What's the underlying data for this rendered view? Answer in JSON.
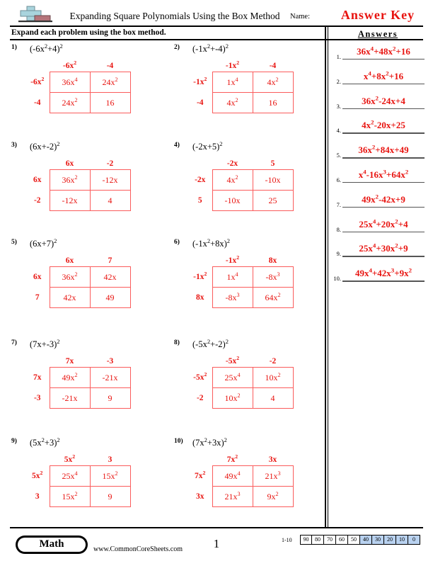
{
  "header": {
    "logo_icon": "plus-block-logo",
    "title": "Expanding Square Polynomials Using the Box Method",
    "name_label": "Name:",
    "name_value": "Answer Key",
    "instructions": "Expand each problem using the box method.",
    "accent_color": "#e8130f"
  },
  "answers_panel": {
    "title": "Answers",
    "items": [
      {
        "num": "1.",
        "value": "36x⁴+48x²+16"
      },
      {
        "num": "2.",
        "value": "x⁴+8x²+16"
      },
      {
        "num": "3.",
        "value": "36x²-24x+4"
      },
      {
        "num": "4.",
        "value": "4x²-20x+25"
      },
      {
        "num": "5.",
        "value": "36x²+84x+49"
      },
      {
        "num": "6.",
        "value": "x⁴-16x³+64x²"
      },
      {
        "num": "7.",
        "value": "49x²-42x+9"
      },
      {
        "num": "8.",
        "value": "25x⁴+20x²+4"
      },
      {
        "num": "9.",
        "value": "25x⁴+30x²+9"
      },
      {
        "num": "10.",
        "value": "49x⁴+42x³+9x²"
      }
    ]
  },
  "problems": [
    {
      "num": "1)",
      "expression": "(-6x²+4)²",
      "col_headers": [
        "-6x²",
        "-4"
      ],
      "row_headers": [
        "-6x²",
        "-4"
      ],
      "cells": [
        [
          "36x⁴",
          "24x²"
        ],
        [
          "24x²",
          "16"
        ]
      ]
    },
    {
      "num": "2)",
      "expression": "(-1x²+-4)²",
      "col_headers": [
        "-1x²",
        "-4"
      ],
      "row_headers": [
        "-1x²",
        "-4"
      ],
      "cells": [
        [
          "1x⁴",
          "4x²"
        ],
        [
          "4x²",
          "16"
        ]
      ]
    },
    {
      "num": "3)",
      "expression": "(6x+-2)²",
      "col_headers": [
        "6x",
        "-2"
      ],
      "row_headers": [
        "6x",
        "-2"
      ],
      "cells": [
        [
          "36x²",
          "-12x"
        ],
        [
          "-12x",
          "4"
        ]
      ]
    },
    {
      "num": "4)",
      "expression": "(-2x+5)²",
      "col_headers": [
        "-2x",
        "5"
      ],
      "row_headers": [
        "-2x",
        "5"
      ],
      "cells": [
        [
          "4x²",
          "-10x"
        ],
        [
          "-10x",
          "25"
        ]
      ]
    },
    {
      "num": "5)",
      "expression": "(6x+7)²",
      "col_headers": [
        "6x",
        "7"
      ],
      "row_headers": [
        "6x",
        "7"
      ],
      "cells": [
        [
          "36x²",
          "42x"
        ],
        [
          "42x",
          "49"
        ]
      ]
    },
    {
      "num": "6)",
      "expression": "(-1x²+8x)²",
      "col_headers": [
        "-1x²",
        "8x"
      ],
      "row_headers": [
        "-1x²",
        "8x"
      ],
      "cells": [
        [
          "1x⁴",
          "-8x³"
        ],
        [
          "-8x³",
          "64x²"
        ]
      ]
    },
    {
      "num": "7)",
      "expression": "(7x+-3)²",
      "col_headers": [
        "7x",
        "-3"
      ],
      "row_headers": [
        "7x",
        "-3"
      ],
      "cells": [
        [
          "49x²",
          "-21x"
        ],
        [
          "-21x",
          "9"
        ]
      ]
    },
    {
      "num": "8)",
      "expression": "(-5x²+-2)²",
      "col_headers": [
        "-5x²",
        "-2"
      ],
      "row_headers": [
        "-5x²",
        "-2"
      ],
      "cells": [
        [
          "25x⁴",
          "10x²"
        ],
        [
          "10x²",
          "4"
        ]
      ]
    },
    {
      "num": "9)",
      "expression": "(5x²+3)²",
      "col_headers": [
        "5x²",
        "3"
      ],
      "row_headers": [
        "5x²",
        "3"
      ],
      "cells": [
        [
          "25x⁴",
          "15x²"
        ],
        [
          "15x²",
          "9"
        ]
      ]
    },
    {
      "num": "10)",
      "expression": "(7x²+3x)²",
      "col_headers": [
        "7x²",
        "3x"
      ],
      "row_headers": [
        "7x²",
        "3x"
      ],
      "cells": [
        [
          "49x⁴",
          "21x³"
        ],
        [
          "21x³",
          "9x²"
        ]
      ]
    }
  ],
  "footer": {
    "subject_badge": "Math",
    "website": "www.CommonCoreSheets.com",
    "page_number": "1",
    "scale_label": "1-10",
    "scale_cells": [
      {
        "value": "90",
        "highlighted": false
      },
      {
        "value": "80",
        "highlighted": false
      },
      {
        "value": "70",
        "highlighted": false
      },
      {
        "value": "60",
        "highlighted": false
      },
      {
        "value": "50",
        "highlighted": false
      },
      {
        "value": "40",
        "highlighted": true
      },
      {
        "value": "30",
        "highlighted": true
      },
      {
        "value": "20",
        "highlighted": true
      },
      {
        "value": "10",
        "highlighted": true
      },
      {
        "value": "0",
        "highlighted": true
      }
    ],
    "highlight_color": "#b9d2f0"
  }
}
